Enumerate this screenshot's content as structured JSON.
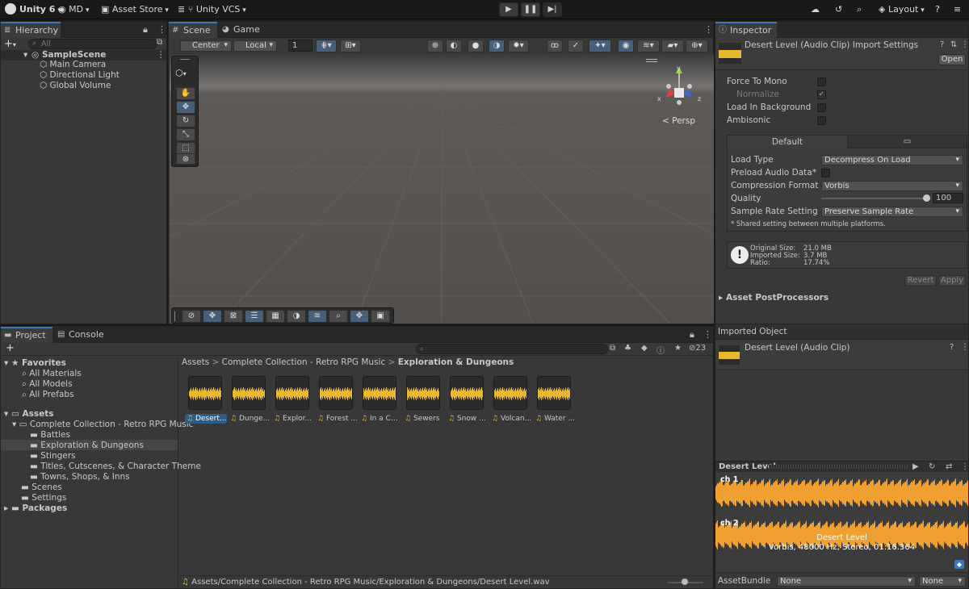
{
  "topbar": {
    "app_title": "Unity 6",
    "account": "MD",
    "asset_store": "Asset Store",
    "vcs": "Unity VCS",
    "layout": "Layout"
  },
  "hierarchy": {
    "tab": "Hierarchy",
    "search_placeholder": "All",
    "scene": "SampleScene",
    "items": [
      "Main Camera",
      "Directional Light",
      "Global Volume"
    ]
  },
  "scene_view": {
    "tabs": [
      "Scene",
      "Game"
    ],
    "pivot": "Center",
    "space": "Local",
    "grid_value": "1",
    "persp_label": "< Persp",
    "gizmo_axes": {
      "x": "x",
      "y": "y",
      "z": "z"
    }
  },
  "project": {
    "tabs": [
      "Project",
      "Console"
    ],
    "hidden_count": "23",
    "favorites_label": "Favorites",
    "favorites": [
      "All Materials",
      "All Models",
      "All Prefabs"
    ],
    "assets_label": "Assets",
    "collection": "Complete Collection - Retro RPG Music",
    "subfolders": [
      "Battles",
      "Exploration & Dungeons",
      "Stingers",
      "Titles, Cutscenes, & Character Theme",
      "Towns, Shops, & Inns"
    ],
    "root_folders": [
      "Scenes",
      "Settings"
    ],
    "packages_label": "Packages",
    "breadcrumb": [
      "Assets",
      "Complete Collection - Retro RPG Music",
      "Exploration & Dungeons"
    ],
    "files": [
      "Desert...",
      "Dunge...",
      "Explor...",
      "Forest ...",
      "In a Ca...",
      "Sewers",
      "Snow ...",
      "Volcan...",
      "Water ..."
    ],
    "status_path": "Assets/Complete Collection - Retro RPG Music/Exploration & Dungeons/Desert Level.wav"
  },
  "inspector": {
    "tab": "Inspector",
    "title": "Desert Level (Audio Clip) Import Settings",
    "open_button": "Open",
    "force_to_mono": "Force To Mono",
    "normalize": "Normalize",
    "load_in_background": "Load In Background",
    "ambisonic": "Ambisonic",
    "platform_tab_default": "Default",
    "load_type_label": "Load Type",
    "load_type_value": "Decompress On Load",
    "preload_label": "Preload Audio Data*",
    "compression_label": "Compression Format",
    "compression_value": "Vorbis",
    "quality_label": "Quality",
    "quality_value": "100",
    "quality_percent": 100,
    "sample_rate_label": "Sample Rate Setting",
    "sample_rate_value": "Preserve Sample Rate",
    "shared_note": "* Shared setting between multiple platforms.",
    "original_size": "Original Size:",
    "original_size_value": "21.0 MB",
    "imported_size": "Imported Size:",
    "imported_size_value": "3.7 MB",
    "ratio": "Ratio:",
    "ratio_value": "17.74%",
    "revert_button": "Revert",
    "apply_button": "Apply",
    "postprocessors": "Asset PostProcessors",
    "imported_object_header": "Imported Object",
    "imported_object_title": "Desert Level (Audio Clip)",
    "preview_title": "Desert Level",
    "ch1": "ch 1",
    "ch2": "ch 2",
    "clip_name": "Desert Level",
    "clip_info": "Vorbis, 48000 Hz, Stereo, 01:16.364",
    "assetbundle_label": "AssetBundle",
    "assetbundle_value": "None",
    "variant_value": "None"
  },
  "colors": {
    "accent": "#3a79bb",
    "waveform": "#f0a030",
    "thumb_wave": "#e8b830",
    "selection": "#2c5d87"
  }
}
